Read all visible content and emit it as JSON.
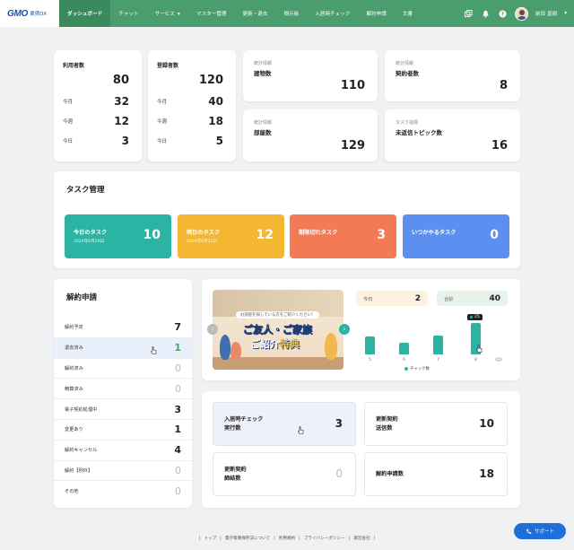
{
  "brand": {
    "logo": "GMO",
    "logo_sub": "賃貸DX"
  },
  "nav": {
    "items": [
      {
        "label": "ダッシュボード"
      },
      {
        "label": "チャット"
      },
      {
        "label": "サービス"
      },
      {
        "label": "マスター管理"
      },
      {
        "label": "更新・退去"
      },
      {
        "label": "揭示板"
      },
      {
        "label": "入居時チェック"
      },
      {
        "label": "解約申請"
      },
      {
        "label": "文書"
      }
    ],
    "user_name": "前田 直樹"
  },
  "users": {
    "title": "利用者数",
    "total": "80",
    "rows": [
      {
        "label": "今月",
        "value": "32"
      },
      {
        "label": "今週",
        "value": "12"
      },
      {
        "label": "今日",
        "value": "3"
      }
    ]
  },
  "registered": {
    "title": "登録者数",
    "total": "120",
    "rows": [
      {
        "label": "今月",
        "value": "40"
      },
      {
        "label": "今週",
        "value": "18"
      },
      {
        "label": "今日",
        "value": "5"
      }
    ]
  },
  "info_cards": [
    {
      "category": "統計情報",
      "title": "建物数",
      "value": "110"
    },
    {
      "category": "統計情報",
      "title": "契約者数",
      "value": "8"
    },
    {
      "category": "統計情報",
      "title": "部屋数",
      "value": "129"
    },
    {
      "category": "タスク指標",
      "title": "未返信トピック数",
      "value": "16"
    }
  ],
  "tasks": {
    "title": "タスク管理",
    "tiles": [
      {
        "title": "今日のタスク",
        "date": "2024年6月20日",
        "value": "10",
        "color": "#2bb3a3"
      },
      {
        "title": "明日のタスク",
        "date": "2024年6月21日",
        "value": "12",
        "color": "#f4b731"
      },
      {
        "title": "期限切れタスク",
        "date": "",
        "value": "3",
        "color": "#f47a56"
      },
      {
        "title": "いつかやるタスク",
        "date": "",
        "value": "0",
        "color": "#5b8ff0"
      }
    ]
  },
  "cancellation": {
    "title": "解約申請",
    "rows": [
      {
        "label": "解約予定",
        "value": "7"
      },
      {
        "label": "退去済み",
        "value": "1"
      },
      {
        "label": "解約済み",
        "value": "0"
      },
      {
        "label": "精算済み",
        "value": "0"
      },
      {
        "label": "電子契約処理中",
        "value": "3"
      },
      {
        "label": "変更あり",
        "value": "1"
      },
      {
        "label": "解約キャンセル",
        "value": "4"
      },
      {
        "label": "解約【例外】",
        "value": "0"
      },
      {
        "label": "その他",
        "value": "0"
      }
    ]
  },
  "banner": {
    "small_text": "お部屋を探している方をご紹介ください！",
    "line1": "ご友人・ご家族",
    "line2_a": "ご紹介",
    "line2_b": "特典"
  },
  "chat_stats": {
    "today_label": "今日",
    "today_value": "2",
    "total_label": "合計",
    "total_value": "40",
    "tooltip_value": "25",
    "legend": "チャック数"
  },
  "chart_data": {
    "type": "bar",
    "categories": [
      "5",
      "6",
      "7",
      "8"
    ],
    "x_unit": "(月)",
    "values": [
      14,
      9,
      15,
      25
    ],
    "ylim": [
      0,
      30
    ],
    "legend": "チャック数",
    "color": "#2bb3a3"
  },
  "checks": [
    {
      "title_1": "入居時チェック",
      "title_2": "実行数",
      "value": "3"
    },
    {
      "title_1": "更新契約",
      "title_2": "送信数",
      "value": "10"
    },
    {
      "title_1": "更新契約",
      "title_2": "締結数",
      "value": "0"
    },
    {
      "title_1": "解約申請数",
      "title_2": "",
      "value": "18"
    }
  ],
  "footer": {
    "links": [
      "トップ",
      "電子帳簿保存法について",
      "利用規約",
      "プライバシーポリシー",
      "運営会社"
    ]
  },
  "support_label": "サポート"
}
